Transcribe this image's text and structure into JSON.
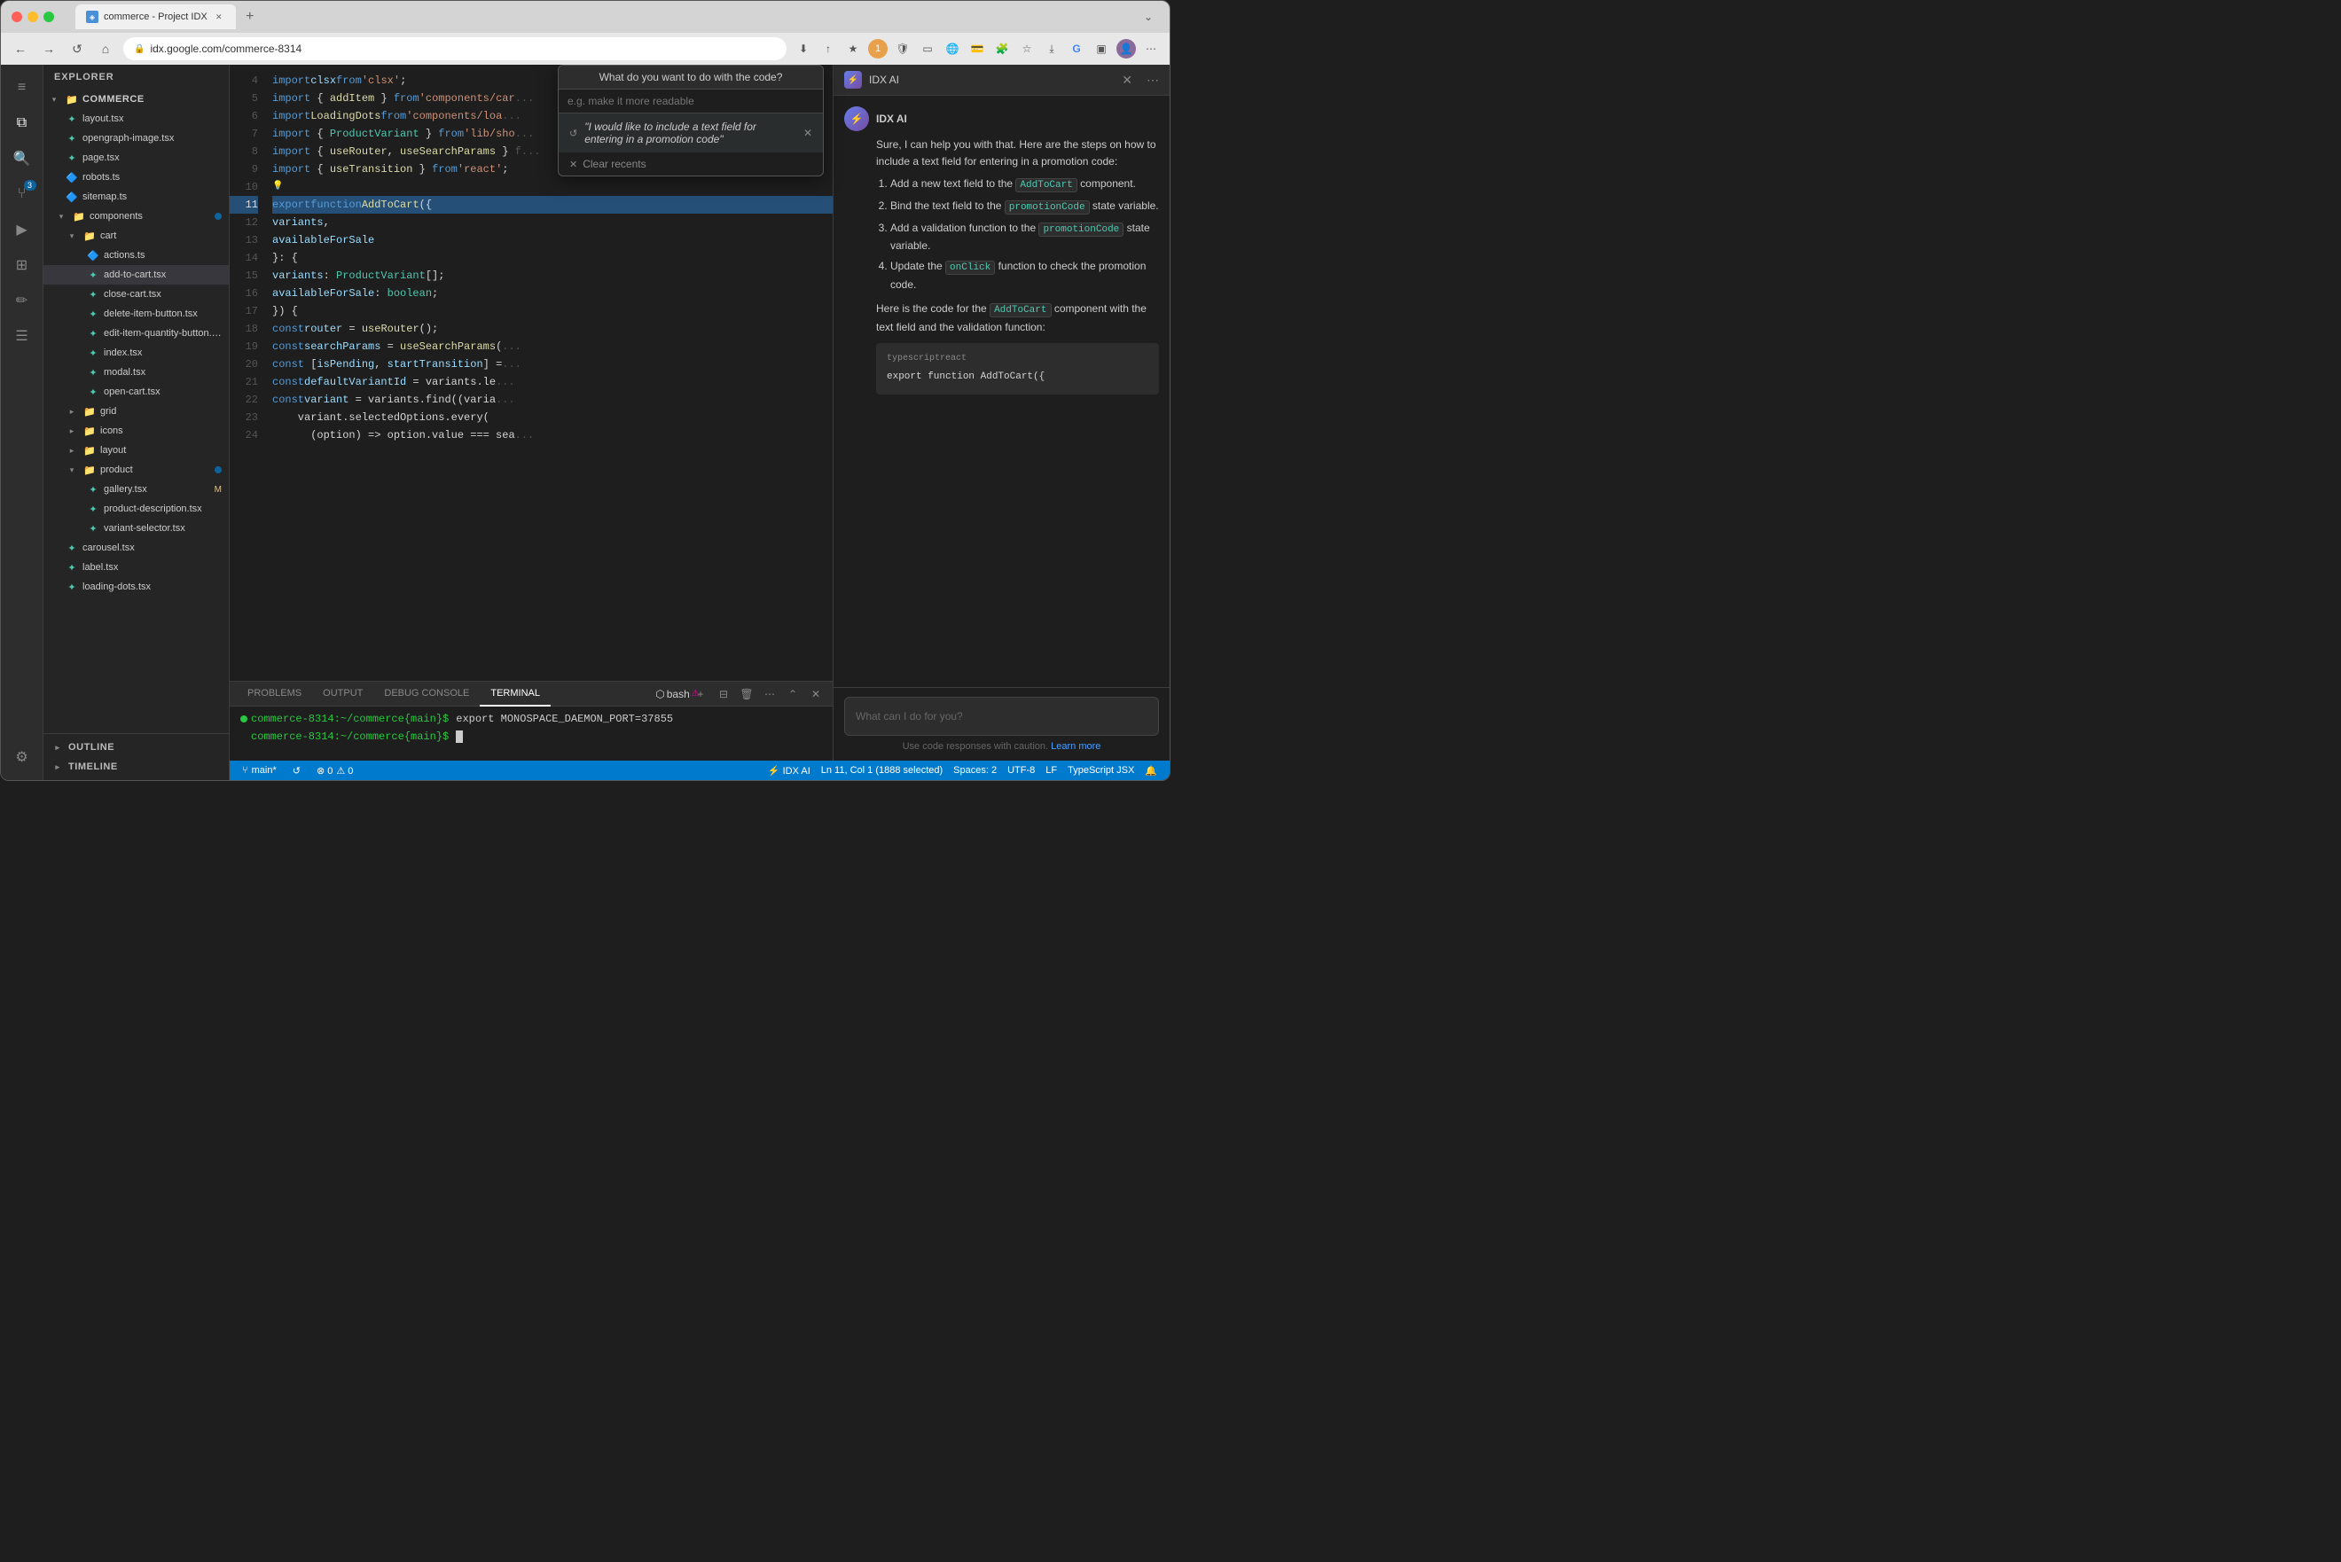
{
  "browser": {
    "tab_title": "commerce - Project IDX",
    "tab_new_label": "+",
    "address": "idx.google.com/commerce-8314",
    "nav_back": "←",
    "nav_forward": "→",
    "nav_refresh": "↺",
    "nav_home": "⌂"
  },
  "sidebar": {
    "explorer_title": "EXPLORER",
    "commerce_label": "COMMERCE",
    "files": [
      {
        "name": "layout.tsx",
        "icon": "tsx",
        "indent": 2
      },
      {
        "name": "opengraph-image.tsx",
        "icon": "tsx",
        "indent": 2
      },
      {
        "name": "page.tsx",
        "icon": "tsx",
        "indent": 2
      },
      {
        "name": "robots.ts",
        "icon": "ts",
        "indent": 2
      },
      {
        "name": "sitemap.ts",
        "icon": "ts",
        "indent": 2
      },
      {
        "name": "components",
        "icon": "folder",
        "indent": 1,
        "expanded": true,
        "badge": true
      },
      {
        "name": "cart",
        "icon": "folder",
        "indent": 2,
        "expanded": true
      },
      {
        "name": "actions.ts",
        "icon": "ts",
        "indent": 3
      },
      {
        "name": "add-to-cart.tsx",
        "icon": "tsx",
        "indent": 3,
        "selected": true
      },
      {
        "name": "close-cart.tsx",
        "icon": "tsx",
        "indent": 3
      },
      {
        "name": "delete-item-button.tsx",
        "icon": "tsx",
        "indent": 3
      },
      {
        "name": "edit-item-quantity-button.tsx",
        "icon": "tsx",
        "indent": 3
      },
      {
        "name": "index.tsx",
        "icon": "tsx",
        "indent": 3
      },
      {
        "name": "modal.tsx",
        "icon": "tsx",
        "indent": 3
      },
      {
        "name": "open-cart.tsx",
        "icon": "tsx",
        "indent": 3
      },
      {
        "name": "grid",
        "icon": "folder",
        "indent": 2,
        "expanded": false
      },
      {
        "name": "icons",
        "icon": "folder",
        "indent": 2,
        "expanded": false
      },
      {
        "name": "layout",
        "icon": "folder",
        "indent": 2,
        "expanded": false
      },
      {
        "name": "product",
        "icon": "folder",
        "indent": 2,
        "expanded": true,
        "badge": true
      },
      {
        "name": "gallery.tsx",
        "icon": "tsx",
        "indent": 3,
        "badge_m": "M"
      },
      {
        "name": "product-description.tsx",
        "icon": "tsx",
        "indent": 3
      },
      {
        "name": "variant-selector.tsx",
        "icon": "tsx",
        "indent": 3
      },
      {
        "name": "carousel.tsx",
        "icon": "tsx",
        "indent": 2
      },
      {
        "name": "label.tsx",
        "icon": "tsx",
        "indent": 2
      },
      {
        "name": "loading-dots.tsx",
        "icon": "tsx",
        "indent": 2
      }
    ],
    "sections": [
      {
        "name": "OUTLINE"
      },
      {
        "name": "TIMELINE"
      }
    ]
  },
  "code": {
    "lines": [
      {
        "num": 4,
        "content": "import clsx from 'clsx';"
      },
      {
        "num": 5,
        "content": "import { addItem } from 'components/car"
      },
      {
        "num": 6,
        "content": "import LoadingDots from 'components/loa"
      },
      {
        "num": 7,
        "content": "import { ProductVariant } from 'lib/sho"
      },
      {
        "num": 8,
        "content": "import { useRouter, useSearchParams } f"
      },
      {
        "num": 9,
        "content": "import { useTransition } from 'react';"
      },
      {
        "num": 10,
        "content": "💡"
      },
      {
        "num": 11,
        "content": "export function AddToCart({"
      },
      {
        "num": 12,
        "content": "  variants,"
      },
      {
        "num": 13,
        "content": "  availableForSale"
      },
      {
        "num": 14,
        "content": "}: {"
      },
      {
        "num": 15,
        "content": "  variants: ProductVariant[];"
      },
      {
        "num": 16,
        "content": "  availableForSale: boolean;"
      },
      {
        "num": 17,
        "content": "}) {"
      },
      {
        "num": 18,
        "content": "  const router = useRouter();"
      },
      {
        "num": 19,
        "content": "  const searchParams = useSearchParams("
      },
      {
        "num": 20,
        "content": "  const [isPending, startTransition] ="
      },
      {
        "num": 21,
        "content": "  const defaultVariantId = variants.le"
      },
      {
        "num": 22,
        "content": "  const variant = variants.find((varia"
      },
      {
        "num": 23,
        "content": "    variant.selectedOptions.every("
      },
      {
        "num": 24,
        "content": "      (option) => option.value === sea"
      }
    ]
  },
  "ai_dialog": {
    "header": "What do you want to do with the code?",
    "placeholder": "e.g. make it more readable",
    "suggestion": "\"I would like to include a text field for entering in a promotion code\"",
    "clear_label": "Clear recents"
  },
  "ai_panel": {
    "title": "IDX AI",
    "sender": "IDX AI",
    "intro": "Sure, I can help you with that. Here are the steps on how to include a text field for entering in a promotion code:",
    "steps": [
      {
        "num": 1,
        "text": "Add a new text field to the ",
        "code": "AddToCart",
        "rest": " component."
      },
      {
        "num": 2,
        "text": "Bind the text field to the ",
        "code": "promotionCode",
        "rest": " state variable."
      },
      {
        "num": 3,
        "text": "Add a validation function to the ",
        "code": "promotionCode",
        "rest": " state variable."
      },
      {
        "num": 4,
        "text": "Update the ",
        "code": "onClick",
        "rest": " function to check the promotion code."
      }
    ],
    "outro_prefix": "Here is the code for the ",
    "outro_code": "AddToCart",
    "outro_suffix": " component with the text field and the validation function:",
    "code_lang": "typescriptreact",
    "code_snippet": "export function AddToCart({",
    "input_placeholder": "What can I do for you?",
    "hint_prefix": "Use code responses with caution.",
    "hint_link": "Learn more"
  },
  "terminal": {
    "tabs": [
      "PROBLEMS",
      "OUTPUT",
      "DEBUG CONSOLE",
      "TERMINAL"
    ],
    "active_tab": "TERMINAL",
    "shell": "bash",
    "lines": [
      "commerce-8314:~/commerce{main}$ export MONOSPACE_DAEMON_PORT=37855",
      "commerce-8314:~/commerce{main}$ "
    ]
  },
  "status_bar": {
    "branch": "main*",
    "sync": "↺",
    "errors": "⊗ 0",
    "warnings": "⚠ 0",
    "ai": "⚡ IDX AI",
    "position": "Ln 11, Col 1 (1888 selected)",
    "spaces": "Spaces: 2",
    "encoding": "UTF-8",
    "line_ending": "LF",
    "language": "TypeScript JSX",
    "bell": "🔔"
  },
  "colors": {
    "accent_blue": "#007acc",
    "sidebar_bg": "#252526",
    "editor_bg": "#1e1e1e",
    "active_tab_bg": "#1e1e1e",
    "inactive_tab_bg": "#2d2d2d"
  }
}
